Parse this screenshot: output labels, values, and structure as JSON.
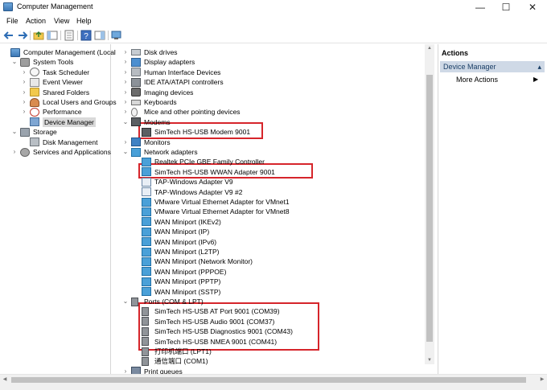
{
  "window": {
    "title": "Computer Management",
    "controls": {
      "minimize": "—",
      "maximize": "☐",
      "close": "✕"
    }
  },
  "menu": [
    "File",
    "Action",
    "View",
    "Help"
  ],
  "left_tree": [
    {
      "label": "Computer Management (Local",
      "expander": "",
      "icon": "computer-icon"
    },
    {
      "label": "System Tools",
      "expander": "⌄",
      "icon": "tools-icon"
    },
    {
      "label": "Task Scheduler",
      "expander": "›",
      "icon": "clock-icon"
    },
    {
      "label": "Event Viewer",
      "expander": "›",
      "icon": "event-viewer-icon"
    },
    {
      "label": "Shared Folders",
      "expander": "›",
      "icon": "folder-icon"
    },
    {
      "label": "Local Users and Groups",
      "expander": "›",
      "icon": "users-icon"
    },
    {
      "label": "Performance",
      "expander": "›",
      "icon": "performance-icon"
    },
    {
      "label": "Device Manager",
      "expander": "",
      "icon": "device-manager-icon",
      "selected": true
    },
    {
      "label": "Storage",
      "expander": "⌄",
      "icon": "storage-icon"
    },
    {
      "label": "Disk Management",
      "expander": "",
      "icon": "disk-icon"
    },
    {
      "label": "Services and Applications",
      "expander": "›",
      "icon": "services-icon"
    }
  ],
  "device_tree": [
    {
      "label": "Disk drives",
      "expander": "›",
      "icon": "drive-icon"
    },
    {
      "label": "Display adapters",
      "expander": "›",
      "icon": "display-icon"
    },
    {
      "label": "Human Interface Devices",
      "expander": "›",
      "icon": "hid-icon"
    },
    {
      "label": "IDE ATA/ATAPI controllers",
      "expander": "›",
      "icon": "ide-icon"
    },
    {
      "label": "Imaging devices",
      "expander": "›",
      "icon": "camera-icon"
    },
    {
      "label": "Keyboards",
      "expander": "›",
      "icon": "keyboard-icon"
    },
    {
      "label": "Mice and other pointing devices",
      "expander": "›",
      "icon": "mouse-icon"
    },
    {
      "label": "Modems",
      "expander": "⌄",
      "icon": "modem-icon"
    },
    {
      "label": "SimTech HS-USB Modem 9001",
      "expander": "",
      "icon": "modem-icon"
    },
    {
      "label": "Monitors",
      "expander": "›",
      "icon": "monitor-icon"
    },
    {
      "label": "Network adapters",
      "expander": "⌄",
      "icon": "network-icon"
    },
    {
      "label": "Realtek PCIe GBE Family Controller",
      "expander": "",
      "icon": "network-icon"
    },
    {
      "label": "SimTech HS-USB WWAN Adapter 9001",
      "expander": "",
      "icon": "network-icon"
    },
    {
      "label": "TAP-Windows Adapter V9",
      "expander": "",
      "icon": "tap-adapter-icon"
    },
    {
      "label": "TAP-Windows Adapter V9 #2",
      "expander": "",
      "icon": "tap-adapter-icon"
    },
    {
      "label": "VMware Virtual Ethernet Adapter for VMnet1",
      "expander": "",
      "icon": "network-icon"
    },
    {
      "label": "VMware Virtual Ethernet Adapter for VMnet8",
      "expander": "",
      "icon": "network-icon"
    },
    {
      "label": "WAN Miniport (IKEv2)",
      "expander": "",
      "icon": "network-icon"
    },
    {
      "label": "WAN Miniport (IP)",
      "expander": "",
      "icon": "network-icon"
    },
    {
      "label": "WAN Miniport (IPv6)",
      "expander": "",
      "icon": "network-icon"
    },
    {
      "label": "WAN Miniport (L2TP)",
      "expander": "",
      "icon": "network-icon"
    },
    {
      "label": "WAN Miniport (Network Monitor)",
      "expander": "",
      "icon": "network-icon"
    },
    {
      "label": "WAN Miniport (PPPOE)",
      "expander": "",
      "icon": "network-icon"
    },
    {
      "label": "WAN Miniport (PPTP)",
      "expander": "",
      "icon": "network-icon"
    },
    {
      "label": "WAN Miniport (SSTP)",
      "expander": "",
      "icon": "network-icon"
    },
    {
      "label": "Ports (COM & LPT)",
      "expander": "⌄",
      "icon": "port-icon"
    },
    {
      "label": "SimTech HS-USB AT Port 9001 (COM39)",
      "expander": "",
      "icon": "port-icon"
    },
    {
      "label": "SimTech HS-USB Audio 9001 (COM37)",
      "expander": "",
      "icon": "port-icon"
    },
    {
      "label": "SimTech HS-USB Diagnostics 9001 (COM43)",
      "expander": "",
      "icon": "port-icon"
    },
    {
      "label": "SimTech HS-USB NMEA 9001 (COM41)",
      "expander": "",
      "icon": "port-icon"
    },
    {
      "label": "打印机端口 (LPT1)",
      "expander": "",
      "icon": "port-icon"
    },
    {
      "label": "通信端口 (COM1)",
      "expander": "",
      "icon": "port-icon"
    },
    {
      "label": "Print queues",
      "expander": "›",
      "icon": "printer-icon"
    }
  ],
  "actions": {
    "header": "Actions",
    "section": "Device Manager",
    "section_chevron": "▴",
    "item": "More Actions",
    "item_arrow": "▶"
  },
  "colors": {
    "highlight_box": "#d6252b",
    "actions_section_bg": "#cfd9e6",
    "selected_row": "#d9d9d9"
  }
}
